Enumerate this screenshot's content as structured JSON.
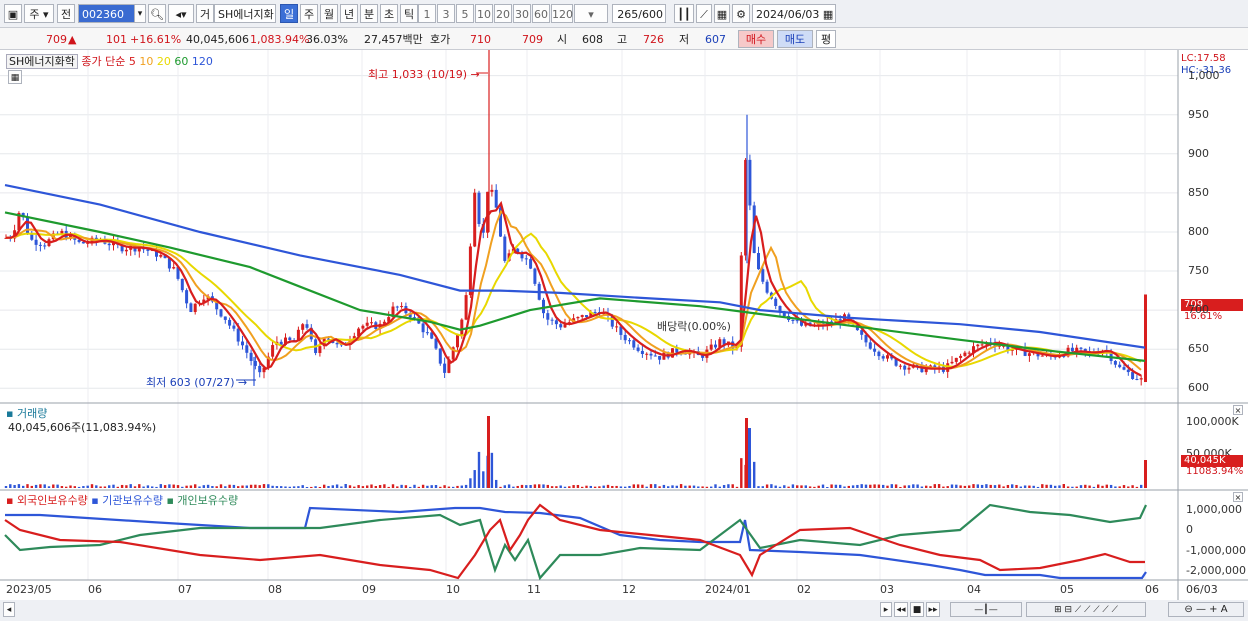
{
  "toolbar": {
    "market": "주",
    "period_type": "전",
    "code": "002360",
    "trade_label": "거",
    "name": "SH에너지화",
    "freqs": [
      "일",
      "주",
      "월",
      "년",
      "분",
      "초",
      "틱"
    ],
    "minutes": [
      "1",
      "3",
      "5",
      "10",
      "20",
      "30",
      "60",
      "120"
    ],
    "count": "265",
    "count_total": "/600",
    "date": "2024/06/03"
  },
  "quote": {
    "price": "709",
    "change": "101",
    "change_pct": "+16.61%",
    "volume": "40,045,606",
    "volume_pct": "1,083.94%",
    "turnover": "36.03%",
    "amount": "27,457백만",
    "hoga_label": "호가",
    "ask": "710",
    "bid": "709",
    "open_label": "시",
    "open": "608",
    "high_label": "고",
    "high": "726",
    "low_label": "저",
    "low": "607",
    "buy_label": "매수",
    "sell_label": "매도",
    "eval_label": "평"
  },
  "price_panel": {
    "name": "SH에너지화학",
    "ma_label": "종가 단순",
    "ma_periods": [
      {
        "p": "5",
        "color": "#d81e1e"
      },
      {
        "p": "10",
        "color": "#f0a020"
      },
      {
        "p": "20",
        "color": "#e8d800"
      },
      {
        "p": "60",
        "color": "#1e9a2e"
      },
      {
        "p": "120",
        "color": "#2e56d8"
      }
    ],
    "high_note": "최고 1,033 (10/19)",
    "low_note": "최저 603 (07/27)",
    "dividend_note": "배당락(0.00%)",
    "lc": "LC:17.58",
    "hc": "HC:-31.36",
    "price_tag": "709",
    "pct_tag": "16.61%"
  },
  "volume_panel": {
    "title": "거래량",
    "value": "40,045,606주(11,083.94%)",
    "axis": [
      "100,000K",
      "50,000K"
    ],
    "tag_value": "40,045K",
    "tag_pct": "11083.94%"
  },
  "holdings_panel": {
    "series": [
      {
        "name": "외국인보유수량",
        "color": "#d81e1e"
      },
      {
        "name": "기관보유수량",
        "color": "#2e56d8"
      },
      {
        "name": "개인보유수량",
        "color": "#2e8a5a"
      }
    ],
    "axis": [
      "1,000,000",
      "0",
      "-1,000,000",
      "-2,000,000"
    ]
  },
  "x_axis": [
    "2023/05",
    "06",
    "07",
    "08",
    "09",
    "10",
    "11",
    "12",
    "2024/01",
    "02",
    "03",
    "04",
    "05",
    "06",
    "06/03"
  ],
  "chart_data": {
    "type": "line",
    "price_ticks": [
      1000,
      950,
      900,
      850,
      800,
      750,
      700,
      650,
      600
    ],
    "ylim": [
      585,
      1020
    ],
    "close_path": [
      [
        0,
        790
      ],
      [
        12,
        795
      ],
      [
        20,
        830
      ],
      [
        30,
        790
      ],
      [
        45,
        785
      ],
      [
        60,
        800
      ],
      [
        80,
        785
      ],
      [
        100,
        790
      ],
      [
        120,
        780
      ],
      [
        140,
        780
      ],
      [
        160,
        770
      ],
      [
        175,
        750
      ],
      [
        190,
        700
      ],
      [
        205,
        720
      ],
      [
        225,
        690
      ],
      [
        245,
        650
      ],
      [
        260,
        615
      ],
      [
        275,
        660
      ],
      [
        295,
        660
      ],
      [
        305,
        690
      ],
      [
        315,
        640
      ],
      [
        325,
        670
      ],
      [
        340,
        650
      ],
      [
        360,
        680
      ],
      [
        380,
        680
      ],
      [
        395,
        705
      ],
      [
        410,
        695
      ],
      [
        430,
        665
      ],
      [
        445,
        620
      ],
      [
        455,
        660
      ],
      [
        465,
        700
      ],
      [
        475,
        860
      ],
      [
        482,
        780
      ],
      [
        488,
        860
      ],
      [
        495,
        840
      ],
      [
        505,
        760
      ],
      [
        515,
        780
      ],
      [
        530,
        760
      ],
      [
        545,
        690
      ],
      [
        560,
        680
      ],
      [
        580,
        690
      ],
      [
        600,
        700
      ],
      [
        620,
        670
      ],
      [
        640,
        650
      ],
      [
        660,
        640
      ],
      [
        680,
        650
      ],
      [
        700,
        640
      ],
      [
        720,
        660
      ],
      [
        738,
        650
      ],
      [
        745,
        900
      ],
      [
        755,
        760
      ],
      [
        765,
        730
      ],
      [
        780,
        700
      ],
      [
        800,
        680
      ],
      [
        820,
        680
      ],
      [
        845,
        690
      ],
      [
        865,
        660
      ],
      [
        885,
        640
      ],
      [
        900,
        630
      ],
      [
        920,
        625
      ],
      [
        945,
        625
      ],
      [
        970,
        650
      ],
      [
        990,
        660
      ],
      [
        1010,
        650
      ],
      [
        1030,
        645
      ],
      [
        1050,
        640
      ],
      [
        1070,
        648
      ],
      [
        1090,
        645
      ],
      [
        1105,
        650
      ],
      [
        1120,
        625
      ],
      [
        1135,
        615
      ],
      [
        1142,
        610
      ],
      [
        1145,
        709
      ]
    ],
    "ma120_path": [
      [
        5,
        860
      ],
      [
        100,
        835
      ],
      [
        200,
        800
      ],
      [
        300,
        770
      ],
      [
        400,
        745
      ],
      [
        460,
        725
      ],
      [
        500,
        725
      ],
      [
        560,
        722
      ],
      [
        650,
        715
      ],
      [
        720,
        710
      ],
      [
        760,
        700
      ],
      [
        850,
        690
      ],
      [
        960,
        682
      ],
      [
        1040,
        672
      ],
      [
        1145,
        652
      ]
    ],
    "ma60_path": [
      [
        5,
        825
      ],
      [
        100,
        800
      ],
      [
        170,
        780
      ],
      [
        250,
        755
      ],
      [
        300,
        730
      ],
      [
        360,
        700
      ],
      [
        430,
        685
      ],
      [
        460,
        675
      ],
      [
        480,
        680
      ],
      [
        530,
        700
      ],
      [
        600,
        715
      ],
      [
        700,
        705
      ],
      [
        760,
        695
      ],
      [
        850,
        680
      ],
      [
        960,
        662
      ],
      [
        1050,
        648
      ],
      [
        1145,
        635
      ]
    ]
  }
}
